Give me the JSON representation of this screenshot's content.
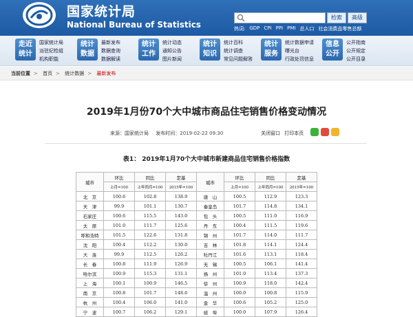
{
  "header": {
    "brand_cn": "国家统计局",
    "brand_en": "National Bureau of Statistics",
    "search_placeholder": "",
    "search_button": "检索",
    "advanced_button": "高级",
    "hot_label": "热词:",
    "hot_links": [
      "GDP",
      "CPI",
      "PPI",
      "PMI",
      "总人口",
      "社会消费品零售总额"
    ]
  },
  "nav": [
    {
      "badge": [
        "走近",
        "统计"
      ],
      "links": [
        "国家统计局",
        "派驻纪检组",
        "机构职能"
      ]
    },
    {
      "badge": [
        "统计",
        "数据"
      ],
      "links": [
        "最新发布",
        "数据查询",
        "数据解读"
      ]
    },
    {
      "badge": [
        "统计",
        "工作"
      ],
      "links": [
        "统计动态",
        "通知公告",
        "图片新闻"
      ]
    },
    {
      "badge": [
        "统计",
        "知识"
      ],
      "links": [
        "统计百科",
        "统计调查",
        "常见问题解答"
      ]
    },
    {
      "badge": [
        "统计",
        "服务"
      ],
      "links": [
        "统计数据申请",
        "曝光台",
        "行政处罚信息"
      ]
    },
    {
      "badge": [
        "信息",
        "公开"
      ],
      "links": [
        "公开指南",
        "公开规定",
        "公开目录"
      ]
    }
  ],
  "breadcrumb": {
    "lead": "当前位置",
    "items": [
      "首页",
      "统计数据",
      "最新发布"
    ]
  },
  "article": {
    "title": "2019年1月份70个大中城市商品住宅销售价格变动情况",
    "source": "来源：国家统计局",
    "published": "发布时间：2019-02-22  09:30",
    "close_label": "关闭窗口",
    "print_label": "打印本页"
  },
  "table": {
    "title": "表1：  2019年1月70个大中城市新建商品住宅销售价格指数",
    "headers": {
      "city": "城市",
      "mom": "环比",
      "yoy": "同比",
      "base": "定基"
    },
    "subheaders": {
      "mom": "上月=100",
      "yoy": "上年同月=100",
      "base": "2015年=100"
    },
    "rows": [
      [
        "北　京",
        "100.6",
        "102.8",
        "138.9",
        "唐　山",
        "100.5",
        "112.9",
        "123.3"
      ],
      [
        "天　津",
        "99.9",
        "101.1",
        "130.7",
        "秦皇岛",
        "101.7",
        "114.8",
        "134.1"
      ],
      [
        "石家庄",
        "100.6",
        "115.5",
        "143.0",
        "包　头",
        "100.5",
        "111.0",
        "116.9"
      ],
      [
        "太　原",
        "101.0",
        "111.7",
        "125.6",
        "丹　东",
        "100.4",
        "111.5",
        "119.6"
      ],
      [
        "呼和浩特",
        "101.5",
        "122.6",
        "131.8",
        "锦　州",
        "101.7",
        "114.0",
        "111.7"
      ],
      [
        "沈　阳",
        "100.4",
        "112.2",
        "130.0",
        "吉　林",
        "101.8",
        "114.1",
        "124.4"
      ],
      [
        "大　连",
        "99.9",
        "112.5",
        "126.2",
        "牡丹江",
        "101.6",
        "113.1",
        "118.4"
      ],
      [
        "长　春",
        "100.8",
        "111.9",
        "126.9",
        "无　锡",
        "100.5",
        "106.1",
        "141.4"
      ],
      [
        "哈尔滨",
        "100.9",
        "115.3",
        "131.1",
        "扬　州",
        "101.0",
        "113.4",
        "137.3"
      ],
      [
        "上　海",
        "100.1",
        "100.9",
        "146.5",
        "徐　州",
        "100.9",
        "118.0",
        "142.4"
      ],
      [
        "南　京",
        "100.8",
        "101.7",
        "148.6",
        "温　州",
        "100.0",
        "100.8",
        "115.9"
      ],
      [
        "杭　州",
        "100.4",
        "106.0",
        "141.0",
        "金　华",
        "100.6",
        "105.2",
        "125.0"
      ],
      [
        "宁　波",
        "100.7",
        "106.2",
        "129.1",
        "蚌　埠",
        "100.0",
        "107.9",
        "126.4"
      ]
    ]
  },
  "colors": {
    "header": "#1d5aa3",
    "accent": "#c00000",
    "badge": "#2c68ad"
  }
}
